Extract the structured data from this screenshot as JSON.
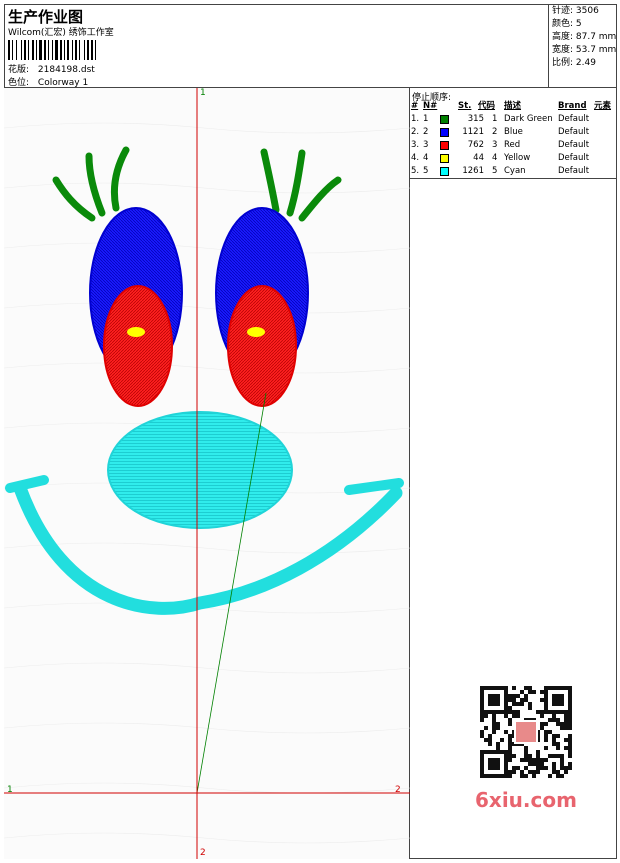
{
  "header": {
    "title": "生产作业图",
    "subtitle": "Wilcom(汇宏) 绣饰工作室",
    "design_label": "花版:",
    "design_value": "2184198.dst",
    "colorway_label": "色位:",
    "colorway_value": "Colorway 1"
  },
  "stats": {
    "stitches": "针迹: 3506",
    "colors": "颜色: 5",
    "height": "高度: 87.7 mm",
    "width": "宽度: 53.7 mm",
    "scale": "比例: 2.49"
  },
  "stop_sequence": {
    "title": "停止顺序:",
    "headers": [
      "#",
      "N#",
      "St.",
      "代码",
      "描述",
      "Brand",
      "元素"
    ],
    "rows": [
      {
        "num": "1.",
        "n": "1",
        "st": "315",
        "code": "1",
        "desc": "Dark Green",
        "brand": "Default",
        "color": "#008000"
      },
      {
        "num": "2.",
        "n": "2",
        "st": "1121",
        "code": "2",
        "desc": "Blue",
        "brand": "Default",
        "color": "#0000ff"
      },
      {
        "num": "3.",
        "n": "3",
        "st": "762",
        "code": "3",
        "desc": "Red",
        "brand": "Default",
        "color": "#ff0000"
      },
      {
        "num": "4.",
        "n": "4",
        "st": "44",
        "code": "4",
        "desc": "Yellow",
        "brand": "Default",
        "color": "#ffff00"
      },
      {
        "num": "5.",
        "n": "5",
        "st": "1261",
        "code": "5",
        "desc": "Cyan",
        "brand": "Default",
        "color": "#00ffff"
      }
    ]
  },
  "axis": {
    "top": "1",
    "bottom": "2",
    "left": "1",
    "right": "2"
  },
  "watermark": {
    "brand": "6xiu.com"
  }
}
